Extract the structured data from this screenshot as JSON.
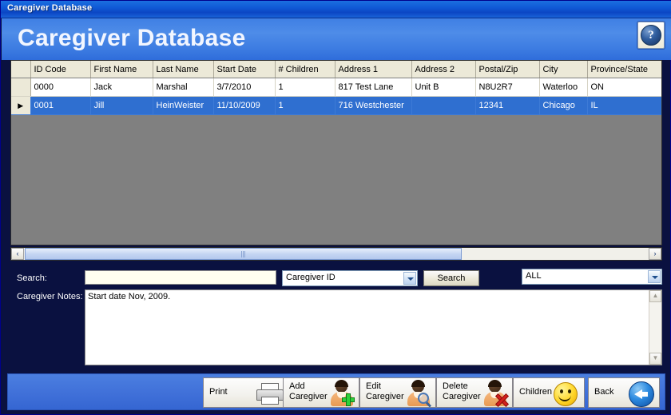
{
  "window": {
    "titlebar_text": "Caregiver Database",
    "header_title": "Caregiver Database",
    "help_glyph": "?"
  },
  "grid": {
    "columns": [
      "",
      "ID Code",
      "First Name",
      "Last Name",
      "Start Date",
      "# Children",
      "Address 1",
      "Address 2",
      "Postal/Zip",
      "City",
      "Province/State"
    ],
    "row_marker": "▶",
    "rows": [
      {
        "selected": false,
        "marker": "",
        "cells": [
          "0000",
          "Jack",
          "Marshal",
          "3/7/2010",
          "1",
          "817 Test Lane",
          "Unit B",
          "N8U2R7",
          "Waterloo",
          "ON"
        ]
      },
      {
        "selected": true,
        "marker": "▶",
        "cells": [
          "0001",
          "Jill",
          "HeinWeister",
          "11/10/2009",
          "1",
          "716 Westchester",
          "",
          "12341",
          "Chicago",
          "IL"
        ]
      }
    ]
  },
  "hscroll": {
    "left_glyph": "‹",
    "right_glyph": "›"
  },
  "search": {
    "label": "Search:",
    "value": "",
    "placeholder": "",
    "field_combo_value": "Caregiver ID",
    "button_label": "Search",
    "filter_combo_value": "ALL"
  },
  "notes": {
    "label": "Caregiver Notes:",
    "value": "Start date Nov, 2009.",
    "scroll_up_glyph": "▲",
    "scroll_down_glyph": "▼"
  },
  "footer": {
    "buttons": [
      {
        "label": "Print",
        "icon": "printer-icon"
      },
      {
        "label": "Add\nCaregiver",
        "icon": "add-person-icon"
      },
      {
        "label": "Edit\nCaregiver",
        "icon": "edit-person-icon"
      },
      {
        "label": "Delete\nCaregiver",
        "icon": "delete-person-icon"
      },
      {
        "label": "Children",
        "icon": "smiley-icon"
      },
      {
        "label": "Back",
        "icon": "back-arrow-icon"
      }
    ]
  },
  "colors": {
    "titlebar_blue": "#0b46c4",
    "header_blue": "#3f7fe4",
    "panel_navy": "#0a1140",
    "footer_blue": "#3f6fd8",
    "selection_blue": "#2f6fd0",
    "grid_empty_gray": "#808080"
  }
}
